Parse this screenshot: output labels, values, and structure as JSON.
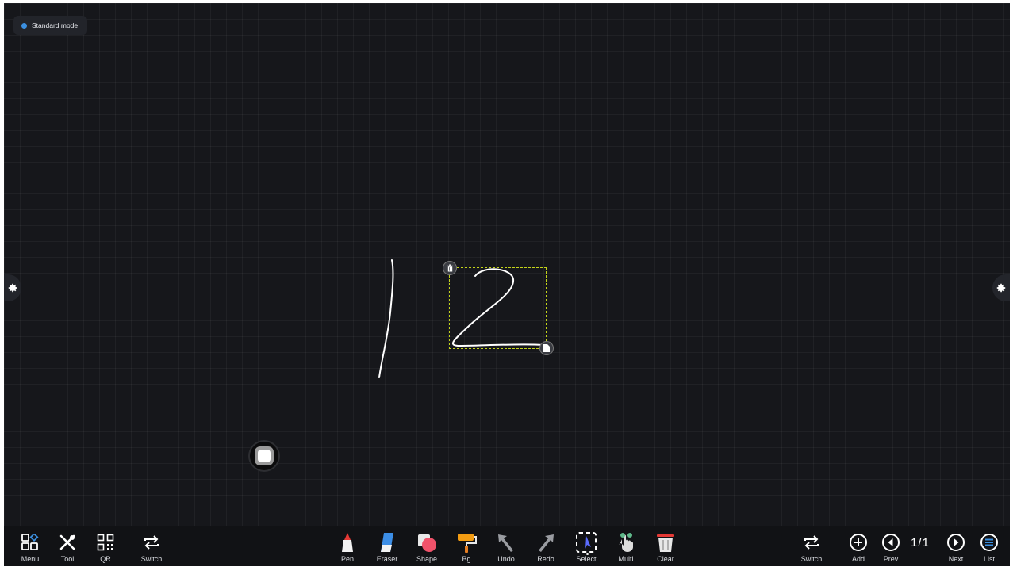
{
  "status": {
    "mode_label": "Standard mode",
    "mode_dot_color": "#3b8fe0"
  },
  "canvas": {
    "background": "#16171b",
    "ink_color": "#ffffff",
    "selection_color": "#c3d31a"
  },
  "left_toolbar": [
    {
      "key": "menu",
      "label": "Menu",
      "icon": "menu-grid-icon"
    },
    {
      "key": "tool",
      "label": "Tool",
      "icon": "tools-icon"
    },
    {
      "key": "qr",
      "label": "QR",
      "icon": "qr-code-icon"
    },
    {
      "key": "switch",
      "label": "Switch",
      "icon": "switch-arrows-icon"
    }
  ],
  "center_toolbar": [
    {
      "key": "pen",
      "label": "Pen",
      "icon": "pen-icon"
    },
    {
      "key": "eraser",
      "label": "Eraser",
      "icon": "eraser-icon"
    },
    {
      "key": "shape",
      "label": "Shape",
      "icon": "shape-icon"
    },
    {
      "key": "bg",
      "label": "Bg",
      "icon": "paint-roller-icon"
    },
    {
      "key": "undo",
      "label": "Undo",
      "icon": "undo-arrow-icon"
    },
    {
      "key": "redo",
      "label": "Redo",
      "icon": "redo-arrow-icon"
    },
    {
      "key": "select",
      "label": "Select",
      "icon": "select-cursor-icon",
      "active": true
    },
    {
      "key": "multi",
      "label": "Multi",
      "icon": "multi-touch-icon"
    },
    {
      "key": "clear",
      "label": "Clear",
      "icon": "trash-bin-icon"
    }
  ],
  "right_toolbar": [
    {
      "key": "switch",
      "label": "Switch",
      "icon": "switch-arrows-icon"
    },
    {
      "key": "add",
      "label": "Add",
      "icon": "plus-circle-icon"
    },
    {
      "key": "prev",
      "label": "Prev",
      "icon": "prev-circle-icon"
    },
    {
      "key": "next",
      "label": "Next",
      "icon": "next-circle-icon"
    },
    {
      "key": "list",
      "label": "List",
      "icon": "list-circle-icon"
    }
  ],
  "pagination": {
    "text": "1/1"
  }
}
